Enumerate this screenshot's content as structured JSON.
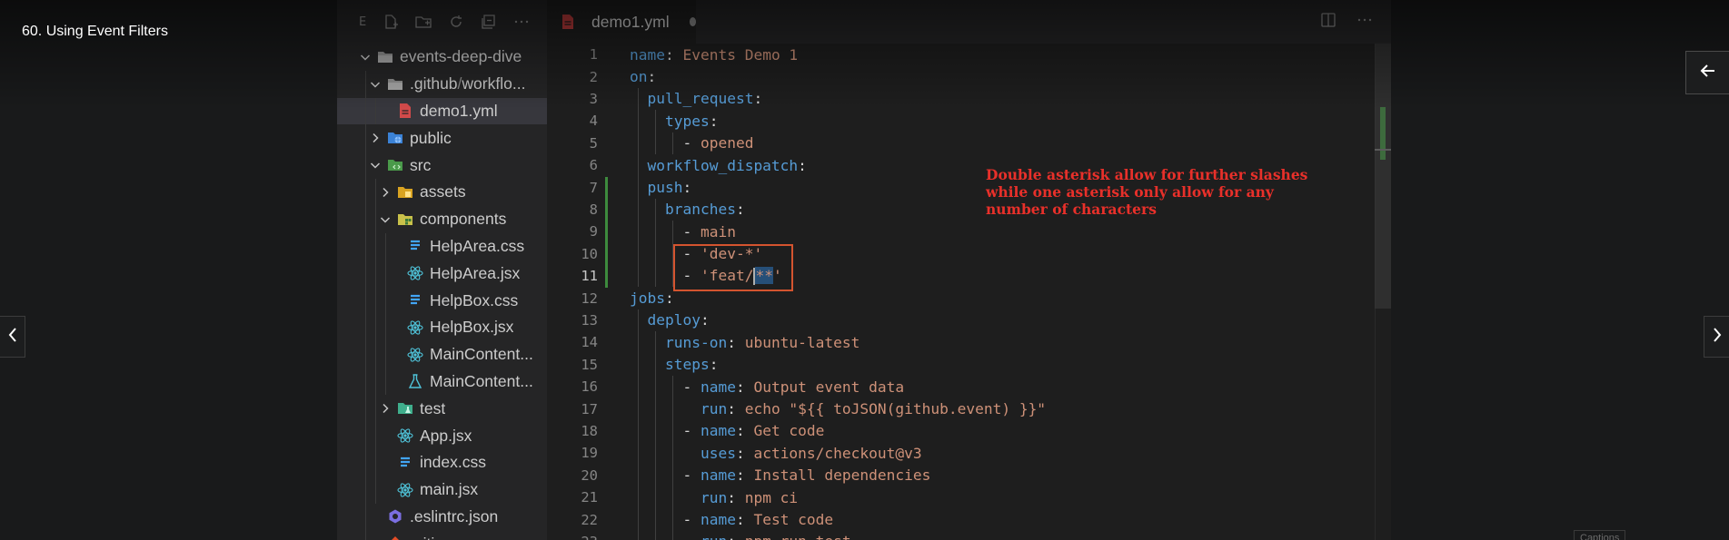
{
  "video": {
    "title": "60. Using Event Filters",
    "captions_label": "Captions"
  },
  "explorer": {
    "toolbar_letter": "E",
    "tree": [
      {
        "label": "events-deep-dive",
        "type": "folder-open",
        "depth": 0,
        "expanded": true
      },
      {
        "label": ".github",
        "label2": "workflo...",
        "type": "folder-open",
        "depth": 1,
        "expanded": true
      },
      {
        "label": "demo1.yml",
        "type": "yaml",
        "depth": 2,
        "selected": true
      },
      {
        "label": "public",
        "type": "folder-public",
        "depth": 1,
        "expanded": false
      },
      {
        "label": "src",
        "type": "folder-src",
        "depth": 1,
        "expanded": true
      },
      {
        "label": "assets",
        "type": "folder-assets",
        "depth": 2,
        "expanded": false
      },
      {
        "label": "components",
        "type": "folder-components",
        "depth": 2,
        "expanded": true
      },
      {
        "label": "HelpArea.css",
        "type": "css",
        "depth": 3
      },
      {
        "label": "HelpArea.jsx",
        "type": "react",
        "depth": 3
      },
      {
        "label": "HelpBox.css",
        "type": "css",
        "depth": 3
      },
      {
        "label": "HelpBox.jsx",
        "type": "react",
        "depth": 3
      },
      {
        "label": "MainContent...",
        "type": "react",
        "depth": 3
      },
      {
        "label": "MainContent...",
        "type": "test",
        "depth": 3
      },
      {
        "label": "test",
        "type": "folder-test",
        "depth": 2,
        "expanded": false
      },
      {
        "label": "App.jsx",
        "type": "react",
        "depth": 2
      },
      {
        "label": "index.css",
        "type": "css",
        "depth": 2
      },
      {
        "label": "main.jsx",
        "type": "react",
        "depth": 2
      },
      {
        "label": ".eslintrc.json",
        "type": "eslint",
        "depth": 1
      },
      {
        "label": ".gitignore",
        "type": "git",
        "depth": 1
      }
    ]
  },
  "editor": {
    "tab_label": "demo1.yml",
    "active_line": 11,
    "lines": [
      [
        {
          "t": "name",
          "c": "k"
        },
        {
          "t": ": ",
          "c": "p"
        },
        {
          "t": "Events Demo 1",
          "c": "s"
        }
      ],
      [
        {
          "t": "on",
          "c": "k"
        },
        {
          "t": ":",
          "c": "p"
        }
      ],
      [
        {
          "t": "  pull_request",
          "c": "k"
        },
        {
          "t": ":",
          "c": "p"
        }
      ],
      [
        {
          "t": "    types",
          "c": "k"
        },
        {
          "t": ":",
          "c": "p"
        }
      ],
      [
        {
          "t": "      - ",
          "c": "p"
        },
        {
          "t": "opened",
          "c": "s"
        }
      ],
      [
        {
          "t": "  workflow_dispatch",
          "c": "k"
        },
        {
          "t": ":",
          "c": "p"
        }
      ],
      [
        {
          "t": "  push",
          "c": "k"
        },
        {
          "t": ":",
          "c": "p"
        }
      ],
      [
        {
          "t": "    branches",
          "c": "k"
        },
        {
          "t": ":",
          "c": "p"
        }
      ],
      [
        {
          "t": "      - ",
          "c": "p"
        },
        {
          "t": "main",
          "c": "s"
        }
      ],
      [
        {
          "t": "      - ",
          "c": "p"
        },
        {
          "t": "'dev-*'",
          "c": "s"
        }
      ],
      [
        {
          "t": "      - ",
          "c": "p"
        },
        {
          "t": "'feat/",
          "c": "s"
        },
        {
          "t": "CURSOR",
          "c": "cursor"
        },
        {
          "t": "**",
          "c": "sel"
        },
        {
          "t": "'",
          "c": "s"
        }
      ],
      [
        {
          "t": "jobs",
          "c": "k"
        },
        {
          "t": ":",
          "c": "p"
        }
      ],
      [
        {
          "t": "  deploy",
          "c": "k"
        },
        {
          "t": ":",
          "c": "p"
        }
      ],
      [
        {
          "t": "    runs-on",
          "c": "k"
        },
        {
          "t": ": ",
          "c": "p"
        },
        {
          "t": "ubuntu-latest",
          "c": "s"
        }
      ],
      [
        {
          "t": "    steps",
          "c": "k"
        },
        {
          "t": ":",
          "c": "p"
        }
      ],
      [
        {
          "t": "      - ",
          "c": "p"
        },
        {
          "t": "name",
          "c": "k"
        },
        {
          "t": ": ",
          "c": "p"
        },
        {
          "t": "Output event data",
          "c": "s"
        }
      ],
      [
        {
          "t": "        run",
          "c": "k"
        },
        {
          "t": ": ",
          "c": "p"
        },
        {
          "t": "echo \"${{ toJSON(github.event) }}\"",
          "c": "s"
        }
      ],
      [
        {
          "t": "      - ",
          "c": "p"
        },
        {
          "t": "name",
          "c": "k"
        },
        {
          "t": ": ",
          "c": "p"
        },
        {
          "t": "Get code",
          "c": "s"
        }
      ],
      [
        {
          "t": "        uses",
          "c": "k"
        },
        {
          "t": ": ",
          "c": "p"
        },
        {
          "t": "actions/checkout@v3",
          "c": "s"
        }
      ],
      [
        {
          "t": "      - ",
          "c": "p"
        },
        {
          "t": "name",
          "c": "k"
        },
        {
          "t": ": ",
          "c": "p"
        },
        {
          "t": "Install dependencies",
          "c": "s"
        }
      ],
      [
        {
          "t": "        run",
          "c": "k"
        },
        {
          "t": ": ",
          "c": "p"
        },
        {
          "t": "npm ci",
          "c": "s"
        }
      ],
      [
        {
          "t": "      - ",
          "c": "p"
        },
        {
          "t": "name",
          "c": "k"
        },
        {
          "t": ": ",
          "c": "p"
        },
        {
          "t": "Test code",
          "c": "s"
        }
      ],
      [
        {
          "t": "        run",
          "c": "k"
        },
        {
          "t": ": ",
          "c": "p"
        },
        {
          "t": "npm run test",
          "c": "s"
        }
      ]
    ]
  },
  "annotation": {
    "text": "Double asterisk allow for further slashes while one asterisk only allow for any number of characters"
  },
  "colors": {
    "keyword": "#569cd6",
    "string": "#ce9178",
    "annotation": "#e8302a",
    "highlight_box": "#d4542f"
  }
}
